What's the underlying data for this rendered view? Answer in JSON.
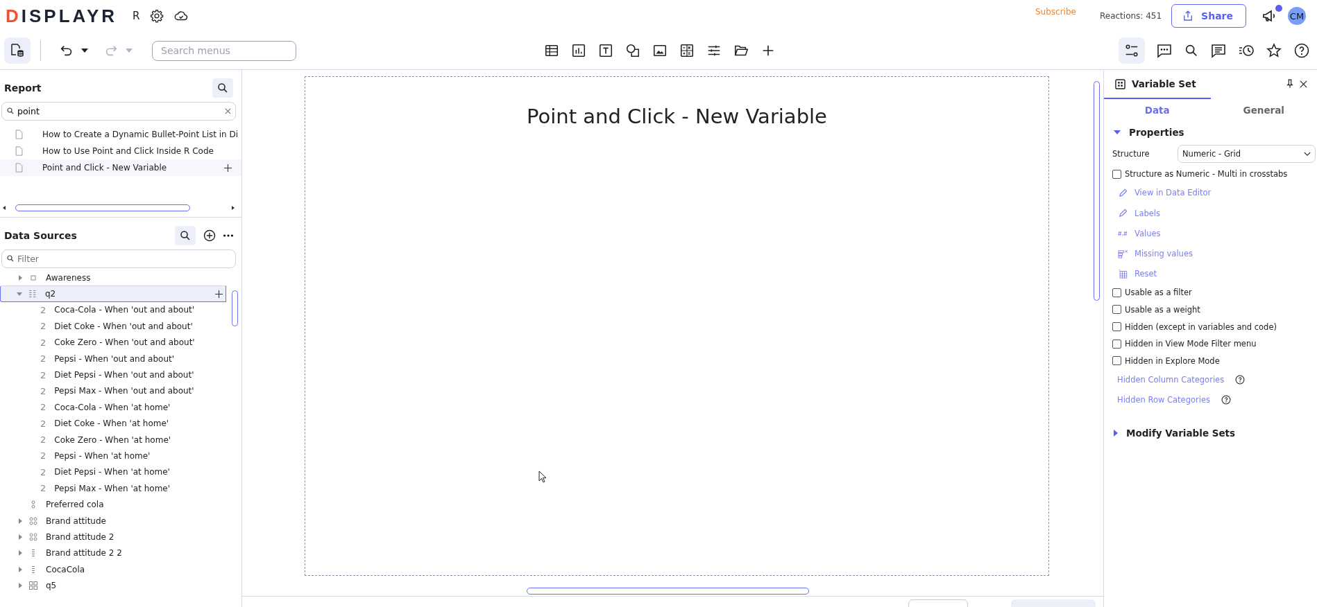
{
  "header": {
    "logo": "DISPLAYR",
    "mode": "R",
    "subscribe": "Subscribe",
    "reactions": "Reactions: 451",
    "share": "Share",
    "avatar": "CM",
    "notification": true
  },
  "toolbar": {
    "search": {
      "placeholder": "Search menus"
    },
    "undo_enabled": true,
    "redo_enabled": false
  },
  "report": {
    "title": "Report",
    "search": {
      "value": "point"
    },
    "items": [
      {
        "label": "How to Create a Dynamic Bullet-Point List in Di",
        "hovered": false
      },
      {
        "label": "How to Use Point and Click Inside R Code",
        "hovered": false
      },
      {
        "label": "Point and Click - New Variable",
        "hovered": true
      }
    ]
  },
  "data_sources": {
    "title": "Data Sources",
    "filter": {
      "placeholder": "Filter"
    },
    "tree": [
      {
        "label": "Awareness",
        "kind": "binary",
        "expanded": false,
        "selected": false
      },
      {
        "label": "q2",
        "kind": "numeric-grid",
        "expanded": true,
        "selected": true,
        "children": [
          {
            "glyph": "2",
            "label": "Coca-Cola - When 'out and about'"
          },
          {
            "glyph": "2",
            "label": "Diet Coke - When 'out and about'"
          },
          {
            "glyph": "2",
            "label": "Coke Zero - When 'out and about'"
          },
          {
            "glyph": "2",
            "label": "Pepsi - When 'out and about'"
          },
          {
            "glyph": "2",
            "label": "Diet Pepsi - When 'out and about'"
          },
          {
            "glyph": "2",
            "label": "Pepsi Max - When 'out and about'"
          },
          {
            "glyph": "2",
            "label": "Coca-Cola - When 'at home'"
          },
          {
            "glyph": "2",
            "label": "Diet Coke - When 'at home'"
          },
          {
            "glyph": "2",
            "label": "Coke Zero - When 'at home'"
          },
          {
            "glyph": "2",
            "label": "Pepsi - When 'at home'"
          },
          {
            "glyph": "2",
            "label": "Diet Pepsi - When 'at home'"
          },
          {
            "glyph": "2",
            "label": "Pepsi Max - When 'at home'"
          }
        ]
      },
      {
        "label": "Preferred cola",
        "kind": "nominal",
        "selected": false
      },
      {
        "label": "Brand attitude",
        "kind": "nominal-multi",
        "expanded": false,
        "selected": false
      },
      {
        "label": "Brand attitude 2",
        "kind": "nominal-multi",
        "expanded": false,
        "selected": false
      },
      {
        "label": "Brand attitude 2 2",
        "kind": "numeric-multi",
        "expanded": false,
        "selected": false
      },
      {
        "label": "CocaCola",
        "kind": "numeric-multi",
        "expanded": false,
        "selected": false
      },
      {
        "label": "q5",
        "kind": "binary-grid",
        "expanded": false,
        "selected": false
      }
    ]
  },
  "canvas": {
    "title": "Point and Click - New Variable"
  },
  "panel": {
    "title": "Variable Set",
    "tabs": [
      {
        "label": "Data",
        "selected": true
      },
      {
        "label": "General",
        "selected": false
      }
    ],
    "properties": {
      "title": "Properties",
      "expanded": true,
      "structure_label": "Structure",
      "structure_value": "Numeric - Grid",
      "structure_checkbox": {
        "label": "Structure as Numeric - Multi in crosstabs",
        "checked": false
      },
      "actions": [
        {
          "kind": "pencil",
          "label": "View in Data Editor"
        },
        {
          "kind": "pencil",
          "label": "Labels"
        },
        {
          "kind": "hash",
          "label": "Values"
        },
        {
          "kind": "missing",
          "label": "Missing values"
        },
        {
          "kind": "reset",
          "label": "Reset"
        }
      ],
      "checkboxes": [
        {
          "label": "Usable as a filter",
          "checked": false
        },
        {
          "label": "Usable as a weight",
          "checked": false
        },
        {
          "label": "Hidden (except in variables and code)",
          "checked": false
        },
        {
          "label": "Hidden in View Mode Filter menu",
          "checked": false
        },
        {
          "label": "Hidden in Explore Mode",
          "checked": false
        }
      ],
      "links": [
        {
          "label": "Hidden Column Categories"
        },
        {
          "label": "Hidden Row Categories"
        }
      ]
    },
    "modify": {
      "title": "Modify Variable Sets",
      "expanded": false
    }
  }
}
